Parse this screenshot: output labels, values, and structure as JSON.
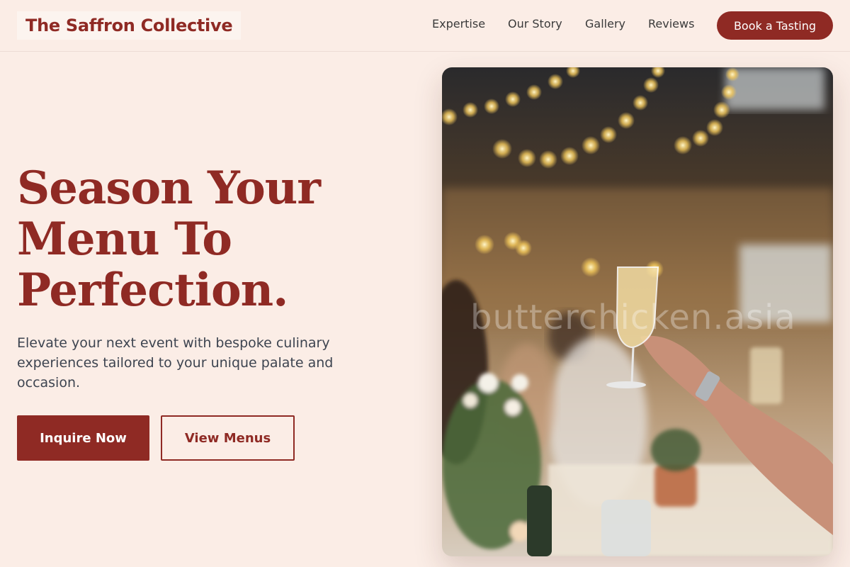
{
  "header": {
    "brand": "The Saffron Collective",
    "nav": [
      {
        "label": "Expertise"
      },
      {
        "label": "Our Story"
      },
      {
        "label": "Gallery"
      },
      {
        "label": "Reviews"
      }
    ],
    "cta_label": "Book a Tasting"
  },
  "hero": {
    "title_lines": [
      "Season Your",
      "Menu To",
      "Perfection."
    ],
    "subtitle": "Elevate your next event with bespoke culinary experiences tailored to your unique palate and occasion.",
    "primary_button": "Inquire Now",
    "secondary_button": "View Menus"
  },
  "image": {
    "subject": "guests toasting with champagne at a string-lit banquet",
    "watermark": "butterchicken.asia"
  },
  "colors": {
    "background": "#fbede6",
    "brand": "#8f2a24",
    "body_text": "#3d4450"
  }
}
